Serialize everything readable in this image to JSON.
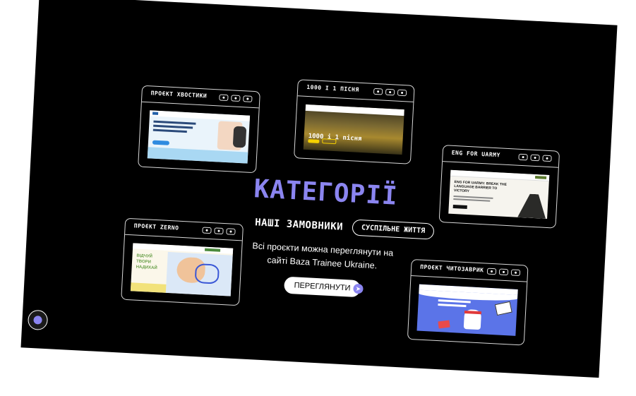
{
  "section": {
    "title": "КАТЕГОРІЇ",
    "customers_label": "НАШІ ЗАМОВНИКИ",
    "category_pill": "СУСПІЛЬНЕ ЖИТТЯ",
    "description": "Всі проєкти можна переглянути на сайті Baza Trainee Ukraine.",
    "view_button": "ПЕРЕГЛЯНУТИ",
    "accent_color": "#8b85f0"
  },
  "projects": [
    {
      "title": "ПРОЄКТ ХВОСТИКИ"
    },
    {
      "title": "1000 І 1 ПІСНЯ",
      "preview_heading": "1000 і 1 пісня"
    },
    {
      "title": "ENG FOR UARMY",
      "preview_heading": "ENG FOR UARMY: BREAK THE LANGUAGE BARRIER TO VICTORY"
    },
    {
      "title": "ПРОЄКТ ZERNO",
      "preview_heading": "ВІДЧУЙ ТВОРИ НАДИХАЙ"
    },
    {
      "title": "ПРОЄКТ ЧИТОЗАВРИК"
    }
  ]
}
